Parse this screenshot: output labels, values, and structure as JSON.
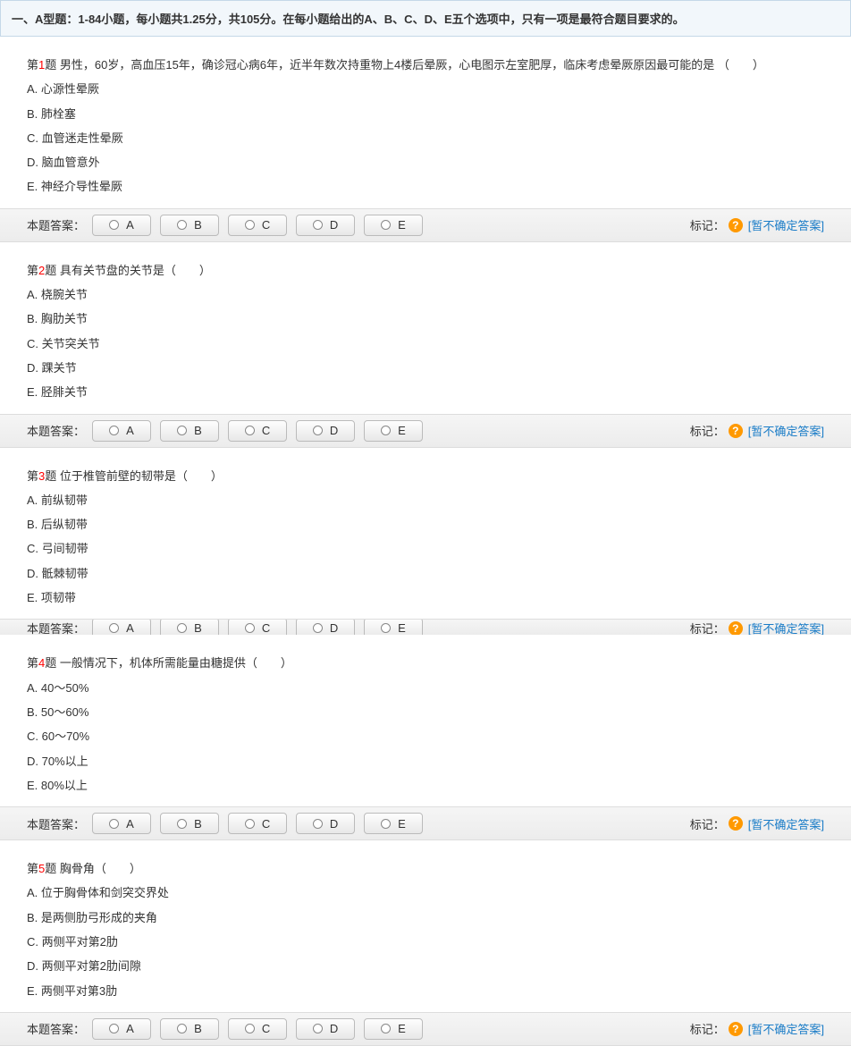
{
  "section_header": "一、A型题：1-84小题，每小题共1.25分，共105分。在每小题给出的A、B、C、D、E五个选项中，只有一项是最符合题目要求的。",
  "answer_label": "本题答案：",
  "mark_label": "标记：",
  "help_icon": "?",
  "unsure_text": "[暂不确定答案]",
  "option_letters": [
    "A",
    "B",
    "C",
    "D",
    "E"
  ],
  "questions": [
    {
      "num_prefix": "第",
      "num": "1",
      "num_suffix": "题",
      "stem": "男性，60岁，高血压15年，确诊冠心病6年，近半年数次持重物上4楼后晕厥，心电图示左室肥厚，临床考虑晕厥原因最可能的是  （　　）",
      "options": [
        "A. 心源性晕厥",
        "B. 肺栓塞",
        "C. 血管迷走性晕厥",
        "D. 脑血管意外",
        "E. 神经介导性晕厥"
      ]
    },
    {
      "num_prefix": "第",
      "num": "2",
      "num_suffix": "题",
      "stem": "具有关节盘的关节是（　　）",
      "options": [
        "A. 桡腕关节",
        "B. 胸肋关节",
        "C. 关节突关节",
        "D. 踝关节",
        "E. 胫腓关节"
      ]
    },
    {
      "num_prefix": "第",
      "num": "3",
      "num_suffix": "题",
      "stem": "位于椎管前壁的韧带是（　　）",
      "options": [
        "A. 前纵韧带",
        "B. 后纵韧带",
        "C. 弓间韧带",
        "D. 骶棘韧带",
        "E. 项韧带"
      ],
      "truncated": true
    },
    {
      "num_prefix": "第",
      "num": "4",
      "num_suffix": "题",
      "stem": "一般情况下，机体所需能量由糖提供（　　）",
      "options": [
        "A. 40～50%",
        "B. 50～60%",
        "C. 60～70%",
        "D. 70%以上",
        "E. 80%以上"
      ]
    },
    {
      "num_prefix": "第",
      "num": "5",
      "num_suffix": "题",
      "stem": "胸骨角（　　）",
      "options": [
        "A. 位于胸骨体和剑突交界处",
        "B. 是两侧肋弓形成的夹角",
        "C. 两侧平对第2肋",
        "D. 两侧平对第2肋间隙",
        "E. 两侧平对第3肋"
      ]
    }
  ]
}
